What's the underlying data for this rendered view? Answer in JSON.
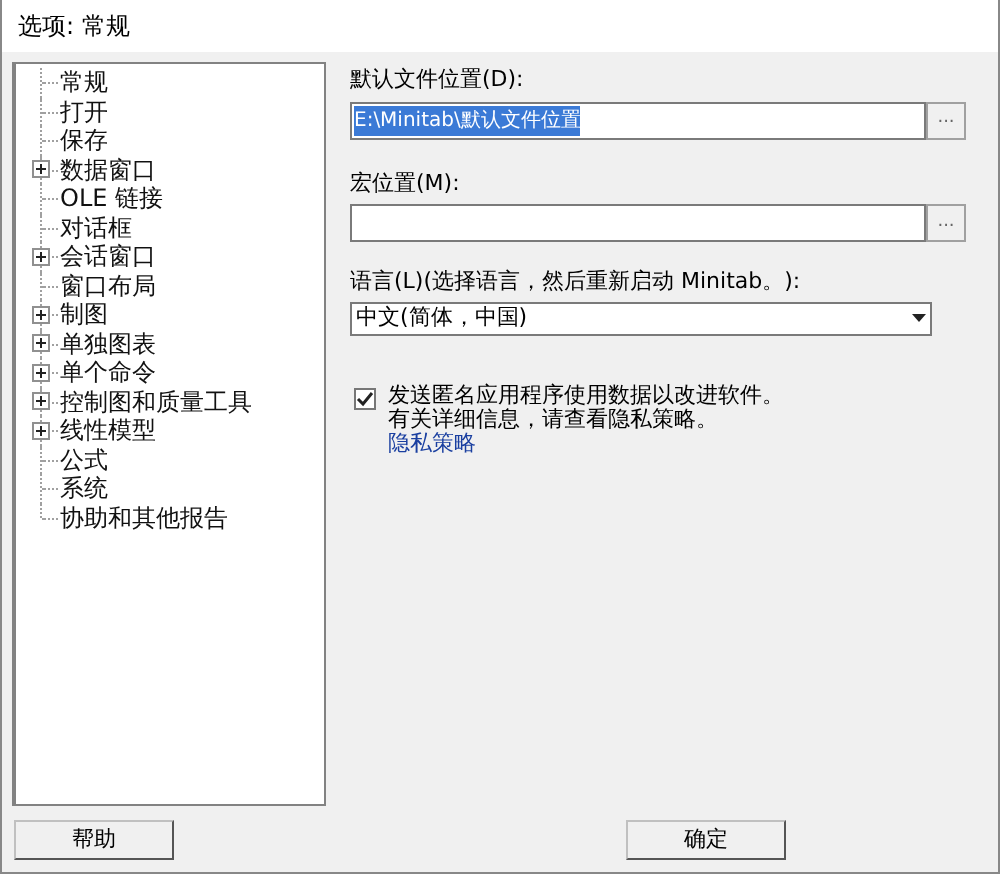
{
  "window": {
    "title": "选项: 常规"
  },
  "tree": {
    "items": [
      {
        "label": "常规",
        "kind": "leaf"
      },
      {
        "label": "打开",
        "kind": "leaf"
      },
      {
        "label": "保存",
        "kind": "leaf"
      },
      {
        "label": "数据窗口",
        "kind": "folder",
        "expanded": false
      },
      {
        "label": "OLE 链接",
        "kind": "leaf"
      },
      {
        "label": "对话框",
        "kind": "leaf"
      },
      {
        "label": "会话窗口",
        "kind": "folder",
        "expanded": false
      },
      {
        "label": "窗口布局",
        "kind": "leaf"
      },
      {
        "label": "制图",
        "kind": "folder",
        "expanded": false
      },
      {
        "label": "单独图表",
        "kind": "folder",
        "expanded": false
      },
      {
        "label": "单个命令",
        "kind": "folder",
        "expanded": false
      },
      {
        "label": "控制图和质量工具",
        "kind": "folder",
        "expanded": false
      },
      {
        "label": "线性模型",
        "kind": "folder",
        "expanded": false
      },
      {
        "label": "公式",
        "kind": "leaf"
      },
      {
        "label": "系统",
        "kind": "leaf"
      },
      {
        "label": "协助和其他报告",
        "kind": "leaf"
      }
    ]
  },
  "default_location": {
    "label": "默认文件位置(D):",
    "value": "E:\\Minitab\\默认文件位置",
    "browse": "..."
  },
  "macro_location": {
    "label": "宏位置(M):",
    "browse": "..."
  },
  "language": {
    "label": "语言(L)(选择语言，然后重新启动 Minitab。):",
    "value": "中文(简体，中国)"
  },
  "usage_data": {
    "checked": true,
    "label": "发送匿名应用程序使用数据以改进软件。",
    "note": "有关详细信息，请查看隐私策略。",
    "link": "隐私策略"
  },
  "buttons": [
    "帮助",
    "确定"
  ]
}
